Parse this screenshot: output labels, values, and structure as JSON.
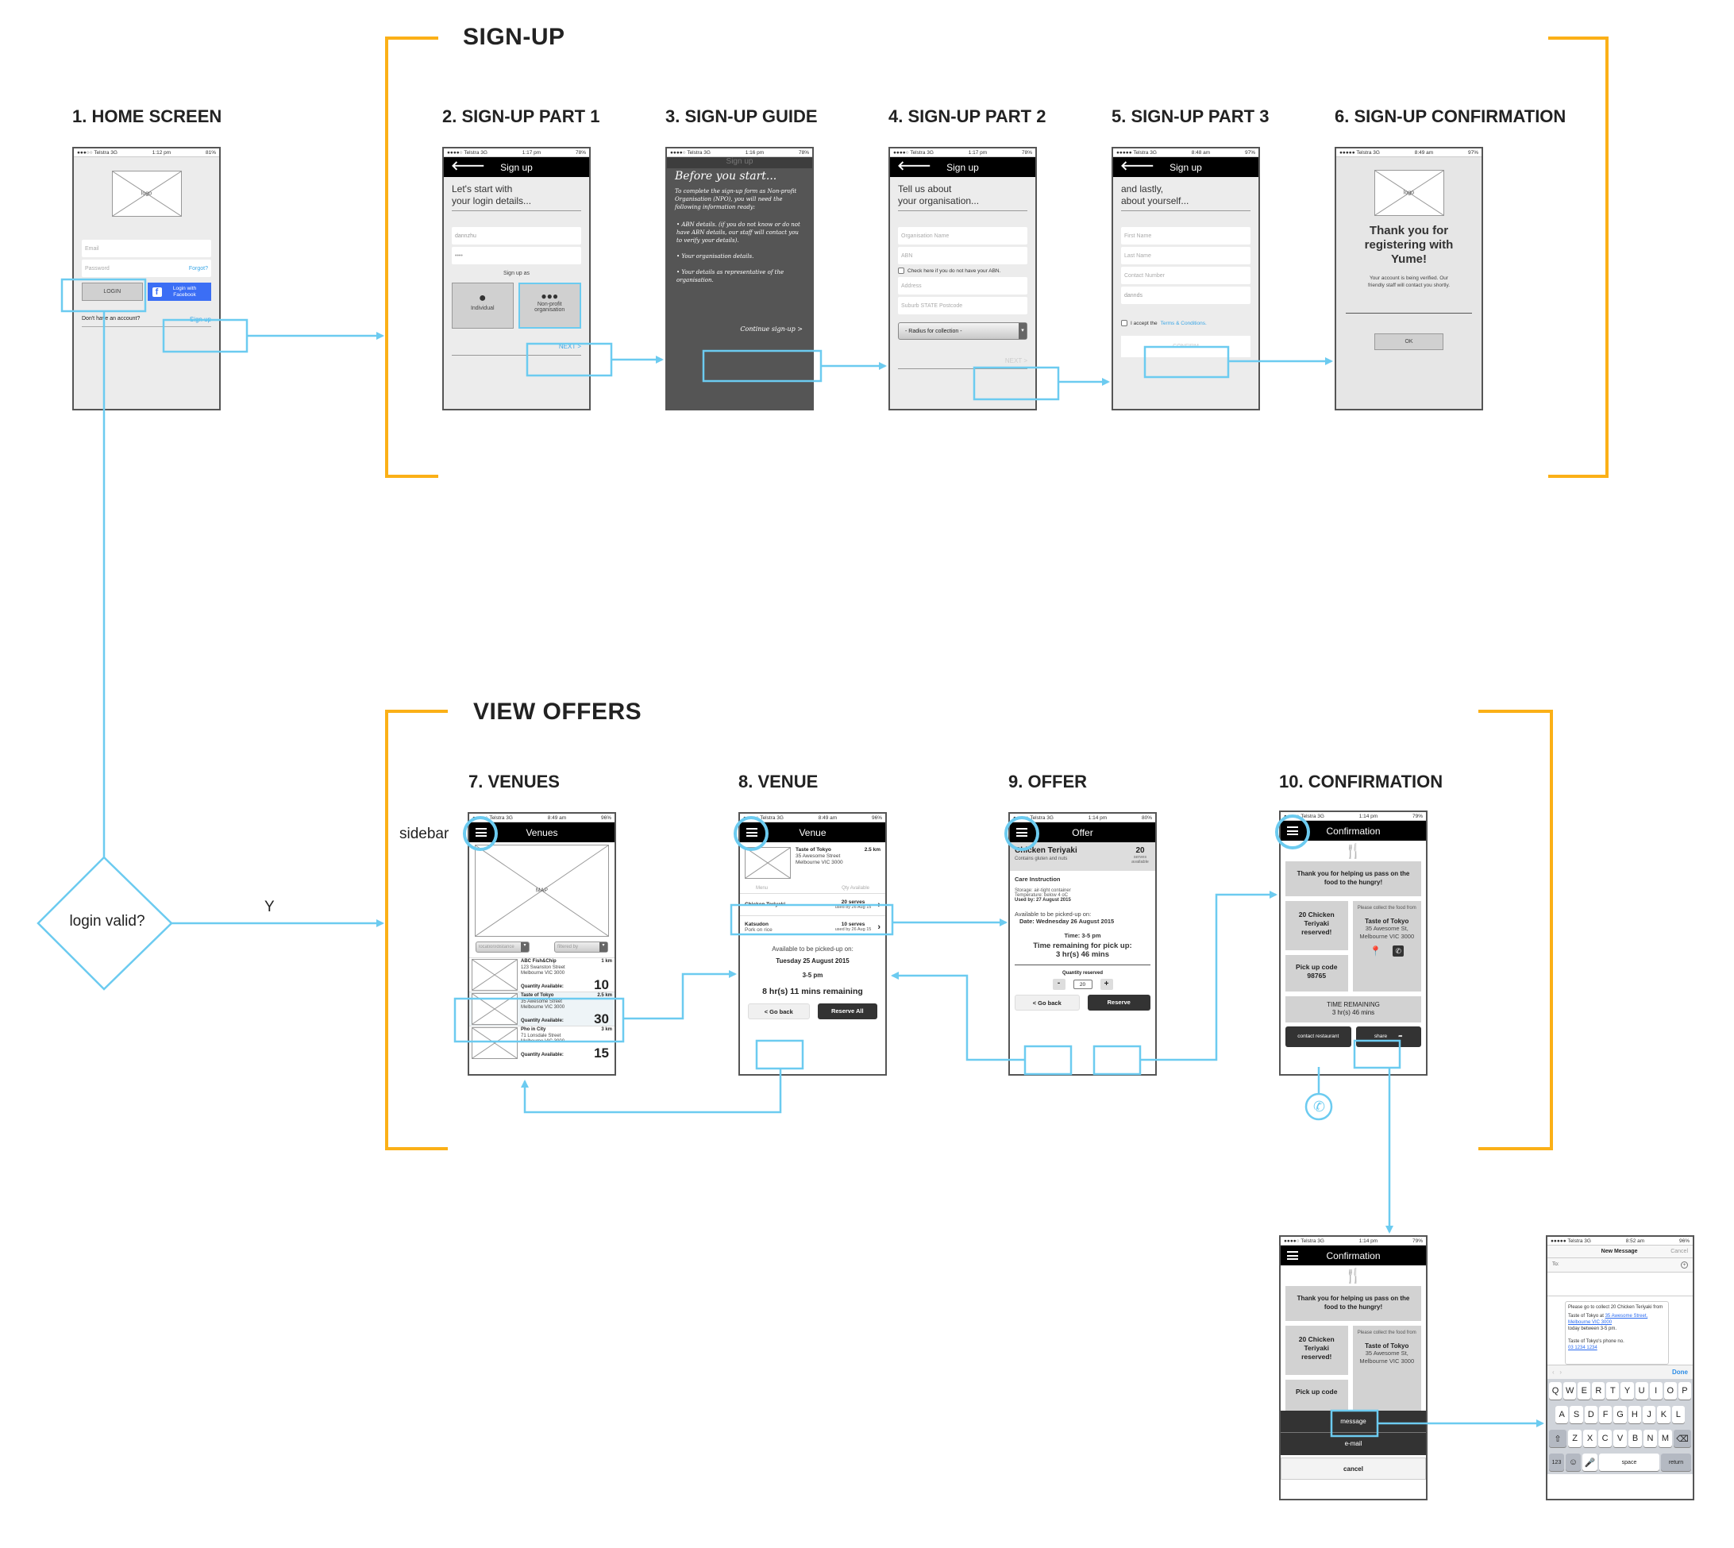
{
  "sections": {
    "signup": "SIGN-UP",
    "view_offers": "VIEW OFFERS"
  },
  "screen_titles": [
    "1. HOME SCREEN",
    "2. SIGN-UP PART 1",
    "3. SIGN-UP GUIDE",
    "4. SIGN-UP PART 2",
    "5. SIGN-UP PART 3",
    "6. SIGN-UP CONFIRMATION",
    "7. VENUES",
    "8. VENUE",
    "9. OFFER",
    "10. CONFIRMATION"
  ],
  "flow": {
    "decision": "login valid?",
    "yes_label": "Y",
    "sidebar_label": "sidebar"
  },
  "colors": {
    "connector": "#6ccbf0",
    "bracket": "#fbb017",
    "facebook": "#3b6ef5",
    "link": "#3aa6e6"
  },
  "home": {
    "status": {
      "carrier": "●●●○○ Telstra  3G",
      "time": "1:12 pm",
      "battery": "81%"
    },
    "logo": "logo",
    "email_placeholder": "Email",
    "password_placeholder": "Password",
    "forgot": "Forgot?",
    "login": "LOGIN",
    "facebook": "Login with Facebook",
    "no_account": "Don't have an account?",
    "signup": "Sign up"
  },
  "signup1": {
    "status": {
      "carrier": "●●●●○ Telstra  3G",
      "time": "1:17 pm",
      "battery": "78%"
    },
    "nav_title": "Sign up",
    "heading_1": "Let's start with",
    "heading_2": "your login details...",
    "username_value": "dannzhu",
    "password_value": "••••",
    "signup_as": "Sign up as",
    "individual": "Individual",
    "nonprofit": "Non-profit organisation",
    "next": "NEXT >"
  },
  "guide": {
    "status": {
      "carrier": "●●●●○ Telstra  3G",
      "time": "1:16 pm",
      "battery": "78%"
    },
    "nav_title": "Sign up",
    "title": "Before you start...",
    "intro": "To complete the sign-up form as Non-profit Organisation (NPO), you will need the following information ready:",
    "bullets": [
      "• ABN details. (if you do not know or do not have ABN details, our staff will contact you to verify your details).",
      "• Your organisation details.",
      "• Your details as representative of the organisation."
    ],
    "continue": "Continue sign-up >"
  },
  "signup2": {
    "status": {
      "carrier": "●●●●○ Telstra  3G",
      "time": "1:17 pm",
      "battery": "78%"
    },
    "nav_title": "Sign up",
    "heading_1": "Tell us about",
    "heading_2": "your organisation...",
    "org_name": "Organisation Name",
    "abn": "ABN",
    "no_abn": "Check here if you do not have your ABN.",
    "address": "Address",
    "suburb": "Suburb STATE Postcode",
    "radius": "- Radius for collection -",
    "next": "NEXT >"
  },
  "signup3": {
    "status": {
      "carrier": "●●●●● Telstra  3G",
      "time": "8:48 am",
      "battery": "97%"
    },
    "nav_title": "Sign up",
    "heading_1": "and lastly,",
    "heading_2": "about yourself...",
    "first_name": "First Name",
    "last_name": "Last Name",
    "contact": "Contact Number",
    "extra_value": "dannds",
    "accept": "I accept the",
    "terms": "Terms & Conditions.",
    "confirm": "CONFIRM"
  },
  "signup_confirm": {
    "status": {
      "carrier": "●●●●● Telstra  3G",
      "time": "8:49 am",
      "battery": "97%"
    },
    "logo": "logo",
    "thanks": "Thank you for registering with Yume!",
    "body": "Your account is being verified. Our friendly staff will contact you shortly.",
    "ok": "OK"
  },
  "venues": {
    "status": {
      "carrier": "●●●●○ Telstra  3G",
      "time": "8:49 am",
      "battery": "96%"
    },
    "nav_title": "Venues",
    "map": "MAP",
    "filter_location": "location/distance",
    "filter_by": "filtered by",
    "qty_label": "Quantity Available:",
    "items": [
      {
        "name": "ABC Fish&Chip",
        "distance": "1 km",
        "street": "123 Swanston Street",
        "city": "Melbourne VIC 3000",
        "qty": "10"
      },
      {
        "name": "Taste of Tokyo",
        "distance": "2.5 km",
        "street": "35 Awesome Street",
        "city": "Melbourne VIC 3000",
        "qty": "30"
      },
      {
        "name": "Pho in City",
        "distance": "3 km",
        "street": "71 Lonsdale Street",
        "city": "Melbourne VIC 3000",
        "qty": "15"
      }
    ]
  },
  "venue": {
    "status": {
      "carrier": "●●●●○ Telstra  3G",
      "time": "8:49 am",
      "battery": "96%"
    },
    "nav_title": "Venue",
    "name": "Taste of Tokyo",
    "distance": "2.5 km",
    "street": "35 Awesome Street",
    "city": "Melbourne VIC 3000",
    "col_menu": "Menu",
    "col_qty": "Qty Available",
    "items": [
      {
        "name": "Chicken Teriyaki",
        "sub": "",
        "serves": "20 serves",
        "used_by": "used by 26 Aug 15"
      },
      {
        "name": "Katsudon",
        "sub": "Pork on rice",
        "serves": "10 serves",
        "used_by": "used by 26 Aug 15"
      }
    ],
    "pickup_label": "Available to be picked-up on:",
    "pickup_date": "Tuesday 25 August 2015",
    "pickup_time": "3-5 pm",
    "remaining": "8 hr(s) 11 mins remaining",
    "go_back": "< Go back",
    "reserve_all": "Reserve All"
  },
  "offer": {
    "status": {
      "carrier": "●●●●○ Telstra  3G",
      "time": "1:14 pm",
      "battery": "80%"
    },
    "nav_title": "Offer",
    "dish": "Chicken Teriyaki",
    "allergens": "Contains gluten and nuts",
    "serves_count": "20",
    "serves_label": "serves available",
    "care_title": "Care Instruction",
    "storage": "Storage: air-tight container",
    "temperature": "Temperature: below 4  oC",
    "used_by": "Used by: 27 August 2015",
    "pickup_label": "Available to be picked-up on:",
    "pickup_date": "Date: Wednesday 26 August 2015",
    "pickup_time": "Time: 3-5 pm",
    "remaining_label": "Time remaining for pick up:",
    "remaining": "3 hr(s) 46 mins",
    "qty_label": "Quantity reserved",
    "qty_value": "20",
    "minus": "-",
    "plus": "+",
    "go_back": "< Go back",
    "reserve": "Reserve"
  },
  "confirmation": {
    "status": {
      "carrier": "●●●●○ Telstra  3G",
      "time": "1:14 pm",
      "battery": "79%"
    },
    "nav_title": "Confirmation",
    "thanks": "Thank you for helping us pass on the food to the hungry!",
    "reserved": "20 Chicken Teriyaki reserved!",
    "pickup_code_label": "Pick up code",
    "pickup_code": "98765",
    "collect_label": "Please collect the food from",
    "venue_name": "Taste of Tokyo",
    "venue_address": "35 Awesome St, Melbourne VIC 3000",
    "time_label": "TIME REMAINING",
    "time_value": "3 hr(s) 46 mins",
    "contact": "contact restaurant",
    "share": "share"
  },
  "share_sheet": {
    "message": "message",
    "email": "e-mail",
    "cancel": "cancel"
  },
  "message": {
    "status": {
      "carrier": "●●●●● Telstra  3G",
      "time": "8:52 am",
      "battery": "96%"
    },
    "title": "New Message",
    "cancel": "Cancel",
    "to": "To:",
    "body_1": "Please go to collect 20 Chicken Teriyaki from",
    "body_2": "Taste of Tokyo at",
    "body_link": "35 Awesome Street, Melbourne VIC 3000",
    "body_3": "today between 3-5 pm.",
    "body_4": "Taste of Tokyo's phone no.",
    "phone": "03 1234 1234",
    "done": "Done",
    "keys_row1": [
      "Q",
      "W",
      "E",
      "R",
      "T",
      "Y",
      "U",
      "I",
      "O",
      "P"
    ],
    "keys_row2": [
      "A",
      "S",
      "D",
      "F",
      "G",
      "H",
      "J",
      "K",
      "L"
    ],
    "keys_row3": [
      "Z",
      "X",
      "C",
      "V",
      "B",
      "N",
      "M"
    ],
    "key_123": "123",
    "key_space": "space",
    "key_return": "return"
  }
}
